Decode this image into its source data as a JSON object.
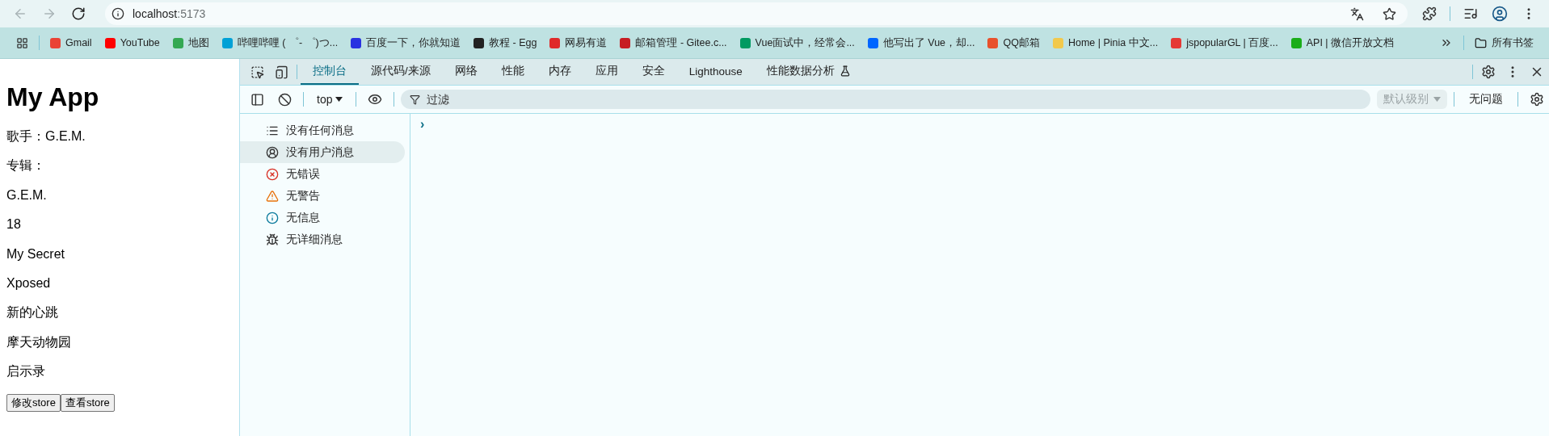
{
  "browser": {
    "nav": [
      {
        "kind": "back",
        "disabled": true
      },
      {
        "kind": "forward",
        "disabled": true
      },
      {
        "kind": "reload",
        "disabled": false
      }
    ],
    "address": {
      "host": "localhost",
      "port": ":5173"
    },
    "bookmarks": [
      {
        "label": "Gmail",
        "color": "#ea4335"
      },
      {
        "label": "YouTube",
        "color": "#ff0000"
      },
      {
        "label": "地图",
        "color": "#34a853"
      },
      {
        "label": "哔哩哔哩 ( ゜- ゜)つ...",
        "color": "#00a1d6"
      },
      {
        "label": "百度一下，你就知道",
        "color": "#2932e1"
      },
      {
        "label": "教程 - Egg",
        "color": "#222222"
      },
      {
        "label": "网易有道",
        "color": "#e02b2b"
      },
      {
        "label": "邮箱管理 - Gitee.c...",
        "color": "#c71d23"
      },
      {
        "label": "Vue面试中，经常会...",
        "color": "#009a61"
      },
      {
        "label": "他写出了 Vue，却...",
        "color": "#0066ff"
      },
      {
        "label": "QQ邮箱",
        "color": "#e8512c"
      },
      {
        "label": "Home | Pinia 中文...",
        "color": "#f2c94c"
      },
      {
        "label": "jspopularGL | 百度...",
        "color": "#e53935"
      },
      {
        "label": "API | 微信开放文档",
        "color": "#1aad19"
      }
    ],
    "all_bookmarks": "所有书签"
  },
  "page": {
    "title": "My App",
    "lines": [
      "歌手：G.E.M.",
      "专辑：",
      "G.E.M.",
      "18",
      "My Secret",
      "Xposed",
      "新的心跳",
      "摩天动物园",
      "启示录"
    ],
    "buttons": [
      "修改store",
      "查看store"
    ]
  },
  "devtools": {
    "tabs": [
      {
        "label": "控制台",
        "selected": true,
        "experimental": false
      },
      {
        "label": "源代码/来源",
        "selected": false,
        "experimental": false
      },
      {
        "label": "网络",
        "selected": false,
        "experimental": false
      },
      {
        "label": "性能",
        "selected": false,
        "experimental": false
      },
      {
        "label": "内存",
        "selected": false,
        "experimental": false
      },
      {
        "label": "应用",
        "selected": false,
        "experimental": false
      },
      {
        "label": "安全",
        "selected": false,
        "experimental": false
      },
      {
        "label": "Lighthouse",
        "selected": false,
        "experimental": false
      },
      {
        "label": "性能数据分析",
        "selected": false,
        "experimental": true
      }
    ],
    "context": "top",
    "filter": {
      "placeholder": "过滤"
    },
    "level": {
      "label": "默认级别",
      "disabled": true
    },
    "issues": "无问题",
    "sidebar": [
      {
        "kind": "all",
        "label": "没有任何消息",
        "selected": false
      },
      {
        "kind": "user",
        "label": "没有用户消息",
        "selected": true
      },
      {
        "kind": "error",
        "label": "无错误",
        "selected": false
      },
      {
        "kind": "warning",
        "label": "无警告",
        "selected": false
      },
      {
        "kind": "info",
        "label": "无信息",
        "selected": false
      },
      {
        "kind": "verbose",
        "label": "无详细消息",
        "selected": false
      }
    ],
    "prompt": "›"
  }
}
